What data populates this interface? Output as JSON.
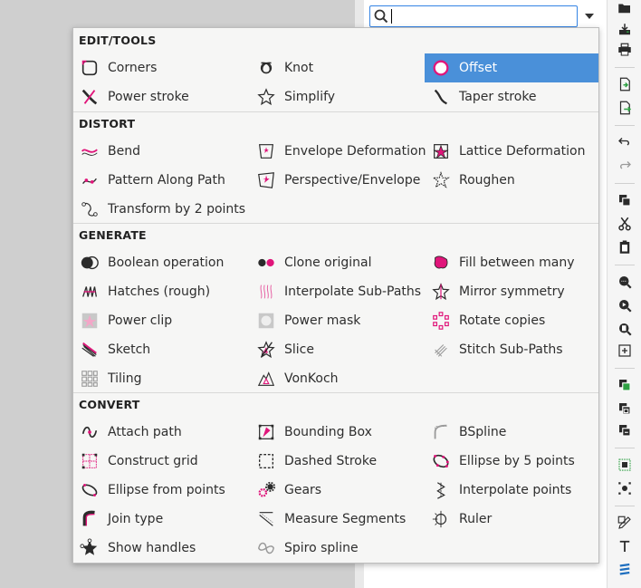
{
  "search": {
    "value": "",
    "placeholder": ""
  },
  "categories": [
    {
      "title": "EDIT/TOOLS",
      "items": [
        {
          "label": "Corners",
          "icon": "corners-icon"
        },
        {
          "label": "Knot",
          "icon": "knot-icon"
        },
        {
          "label": "Offset",
          "icon": "offset-icon",
          "selected": true
        },
        {
          "label": "Power stroke",
          "icon": "power-stroke-icon"
        },
        {
          "label": "Simplify",
          "icon": "simplify-icon"
        },
        {
          "label": "Taper stroke",
          "icon": "taper-stroke-icon"
        }
      ]
    },
    {
      "title": "DISTORT",
      "items": [
        {
          "label": "Bend",
          "icon": "bend-icon"
        },
        {
          "label": "Envelope Deformation",
          "icon": "envelope-deformation-icon"
        },
        {
          "label": "Lattice Deformation",
          "icon": "lattice-deformation-icon"
        },
        {
          "label": "Pattern Along Path",
          "icon": "pattern-along-path-icon"
        },
        {
          "label": "Perspective/Envelope",
          "icon": "perspective-envelope-icon"
        },
        {
          "label": "Roughen",
          "icon": "roughen-icon"
        },
        {
          "label": "Transform by 2 points",
          "icon": "transform-2-points-icon"
        }
      ]
    },
    {
      "title": "GENERATE",
      "items": [
        {
          "label": "Boolean operation",
          "icon": "boolean-operation-icon"
        },
        {
          "label": "Clone original",
          "icon": "clone-original-icon"
        },
        {
          "label": "Fill between many",
          "icon": "fill-between-many-icon"
        },
        {
          "label": "Hatches (rough)",
          "icon": "hatches-icon"
        },
        {
          "label": "Interpolate Sub-Paths",
          "icon": "interpolate-subpaths-icon"
        },
        {
          "label": "Mirror symmetry",
          "icon": "mirror-symmetry-icon"
        },
        {
          "label": "Power clip",
          "icon": "power-clip-icon"
        },
        {
          "label": "Power mask",
          "icon": "power-mask-icon"
        },
        {
          "label": "Rotate copies",
          "icon": "rotate-copies-icon"
        },
        {
          "label": "Sketch",
          "icon": "sketch-icon"
        },
        {
          "label": "Slice",
          "icon": "slice-icon"
        },
        {
          "label": "Stitch Sub-Paths",
          "icon": "stitch-subpaths-icon"
        },
        {
          "label": "Tiling",
          "icon": "tiling-icon"
        },
        {
          "label": "VonKoch",
          "icon": "vonkoch-icon"
        }
      ]
    },
    {
      "title": "CONVERT",
      "items": [
        {
          "label": "Attach path",
          "icon": "attach-path-icon"
        },
        {
          "label": "Bounding Box",
          "icon": "bounding-box-icon"
        },
        {
          "label": "BSpline",
          "icon": "bspline-icon"
        },
        {
          "label": "Construct grid",
          "icon": "construct-grid-icon"
        },
        {
          "label": "Dashed Stroke",
          "icon": "dashed-stroke-icon"
        },
        {
          "label": "Ellipse by 5 points",
          "icon": "ellipse-5-points-icon"
        },
        {
          "label": "Ellipse from points",
          "icon": "ellipse-from-points-icon"
        },
        {
          "label": "Gears",
          "icon": "gears-icon"
        },
        {
          "label": "Interpolate points",
          "icon": "interpolate-points-icon"
        },
        {
          "label": "Join type",
          "icon": "join-type-icon"
        },
        {
          "label": "Measure Segments",
          "icon": "measure-segments-icon"
        },
        {
          "label": "Ruler",
          "icon": "ruler-icon"
        },
        {
          "label": "Show handles",
          "icon": "show-handles-icon"
        },
        {
          "label": "Spiro spline",
          "icon": "spiro-spline-icon"
        }
      ]
    }
  ],
  "toolbar": [
    {
      "icon": "open-icon"
    },
    {
      "icon": "save-icon"
    },
    {
      "icon": "print-icon"
    },
    {
      "icon": "import-icon"
    },
    {
      "icon": "export-icon"
    },
    {
      "icon": "undo-icon"
    },
    {
      "icon": "redo-icon"
    },
    {
      "icon": "copy-icon"
    },
    {
      "icon": "cut-icon"
    },
    {
      "icon": "paste-icon"
    },
    {
      "icon": "zoom-selection-icon"
    },
    {
      "icon": "zoom-drawing-icon"
    },
    {
      "icon": "zoom-page-icon"
    },
    {
      "icon": "zoom-center-icon"
    },
    {
      "icon": "duplicate-icon"
    },
    {
      "icon": "clone-icon"
    },
    {
      "icon": "unlink-clone-icon"
    },
    {
      "icon": "group-icon"
    },
    {
      "icon": "ungroup-icon"
    },
    {
      "icon": "fill-stroke-icon"
    },
    {
      "icon": "text-font-icon"
    },
    {
      "icon": "layers-icon"
    }
  ],
  "colors": {
    "accent": "#4a90d9",
    "pink": "#e0157a",
    "border": "#3584e4"
  }
}
